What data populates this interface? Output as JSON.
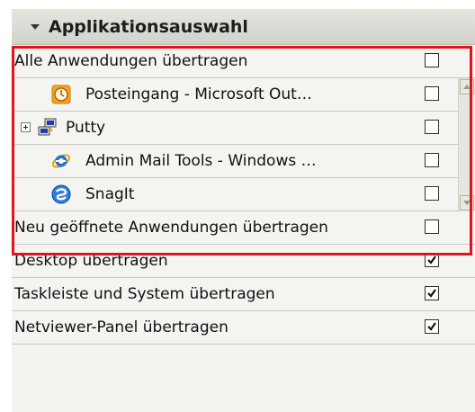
{
  "panel": {
    "title": "Applikationsauswahl",
    "header_icon": "chevron-down-icon"
  },
  "all_apps": {
    "label": "Alle Anwendungen übertragen",
    "checked": false
  },
  "apps": [
    {
      "label": "Posteingang - Microsoft Out…",
      "icon": "outlook-icon",
      "checked": false,
      "expandable": false
    },
    {
      "label": "Putty",
      "icon": "putty-icon",
      "checked": false,
      "expandable": true
    },
    {
      "label": "Admin Mail Tools - Windows …",
      "icon": "internet-explorer-icon",
      "checked": false,
      "expandable": false
    },
    {
      "label": "SnagIt",
      "icon": "snagit-icon",
      "checked": false,
      "expandable": false
    }
  ],
  "options": [
    {
      "label": "Neu geöffnete Anwendungen übertragen",
      "checked": false
    },
    {
      "label": "Desktop übertragen",
      "checked": true
    },
    {
      "label": "Taskleiste und System übertragen",
      "checked": true
    },
    {
      "label": "Netviewer-Panel übertragen",
      "checked": true
    }
  ],
  "colors": {
    "highlight": "#e0141b",
    "panel_bg": "#f3f3f0",
    "header_bg": "#d8d8d2"
  }
}
